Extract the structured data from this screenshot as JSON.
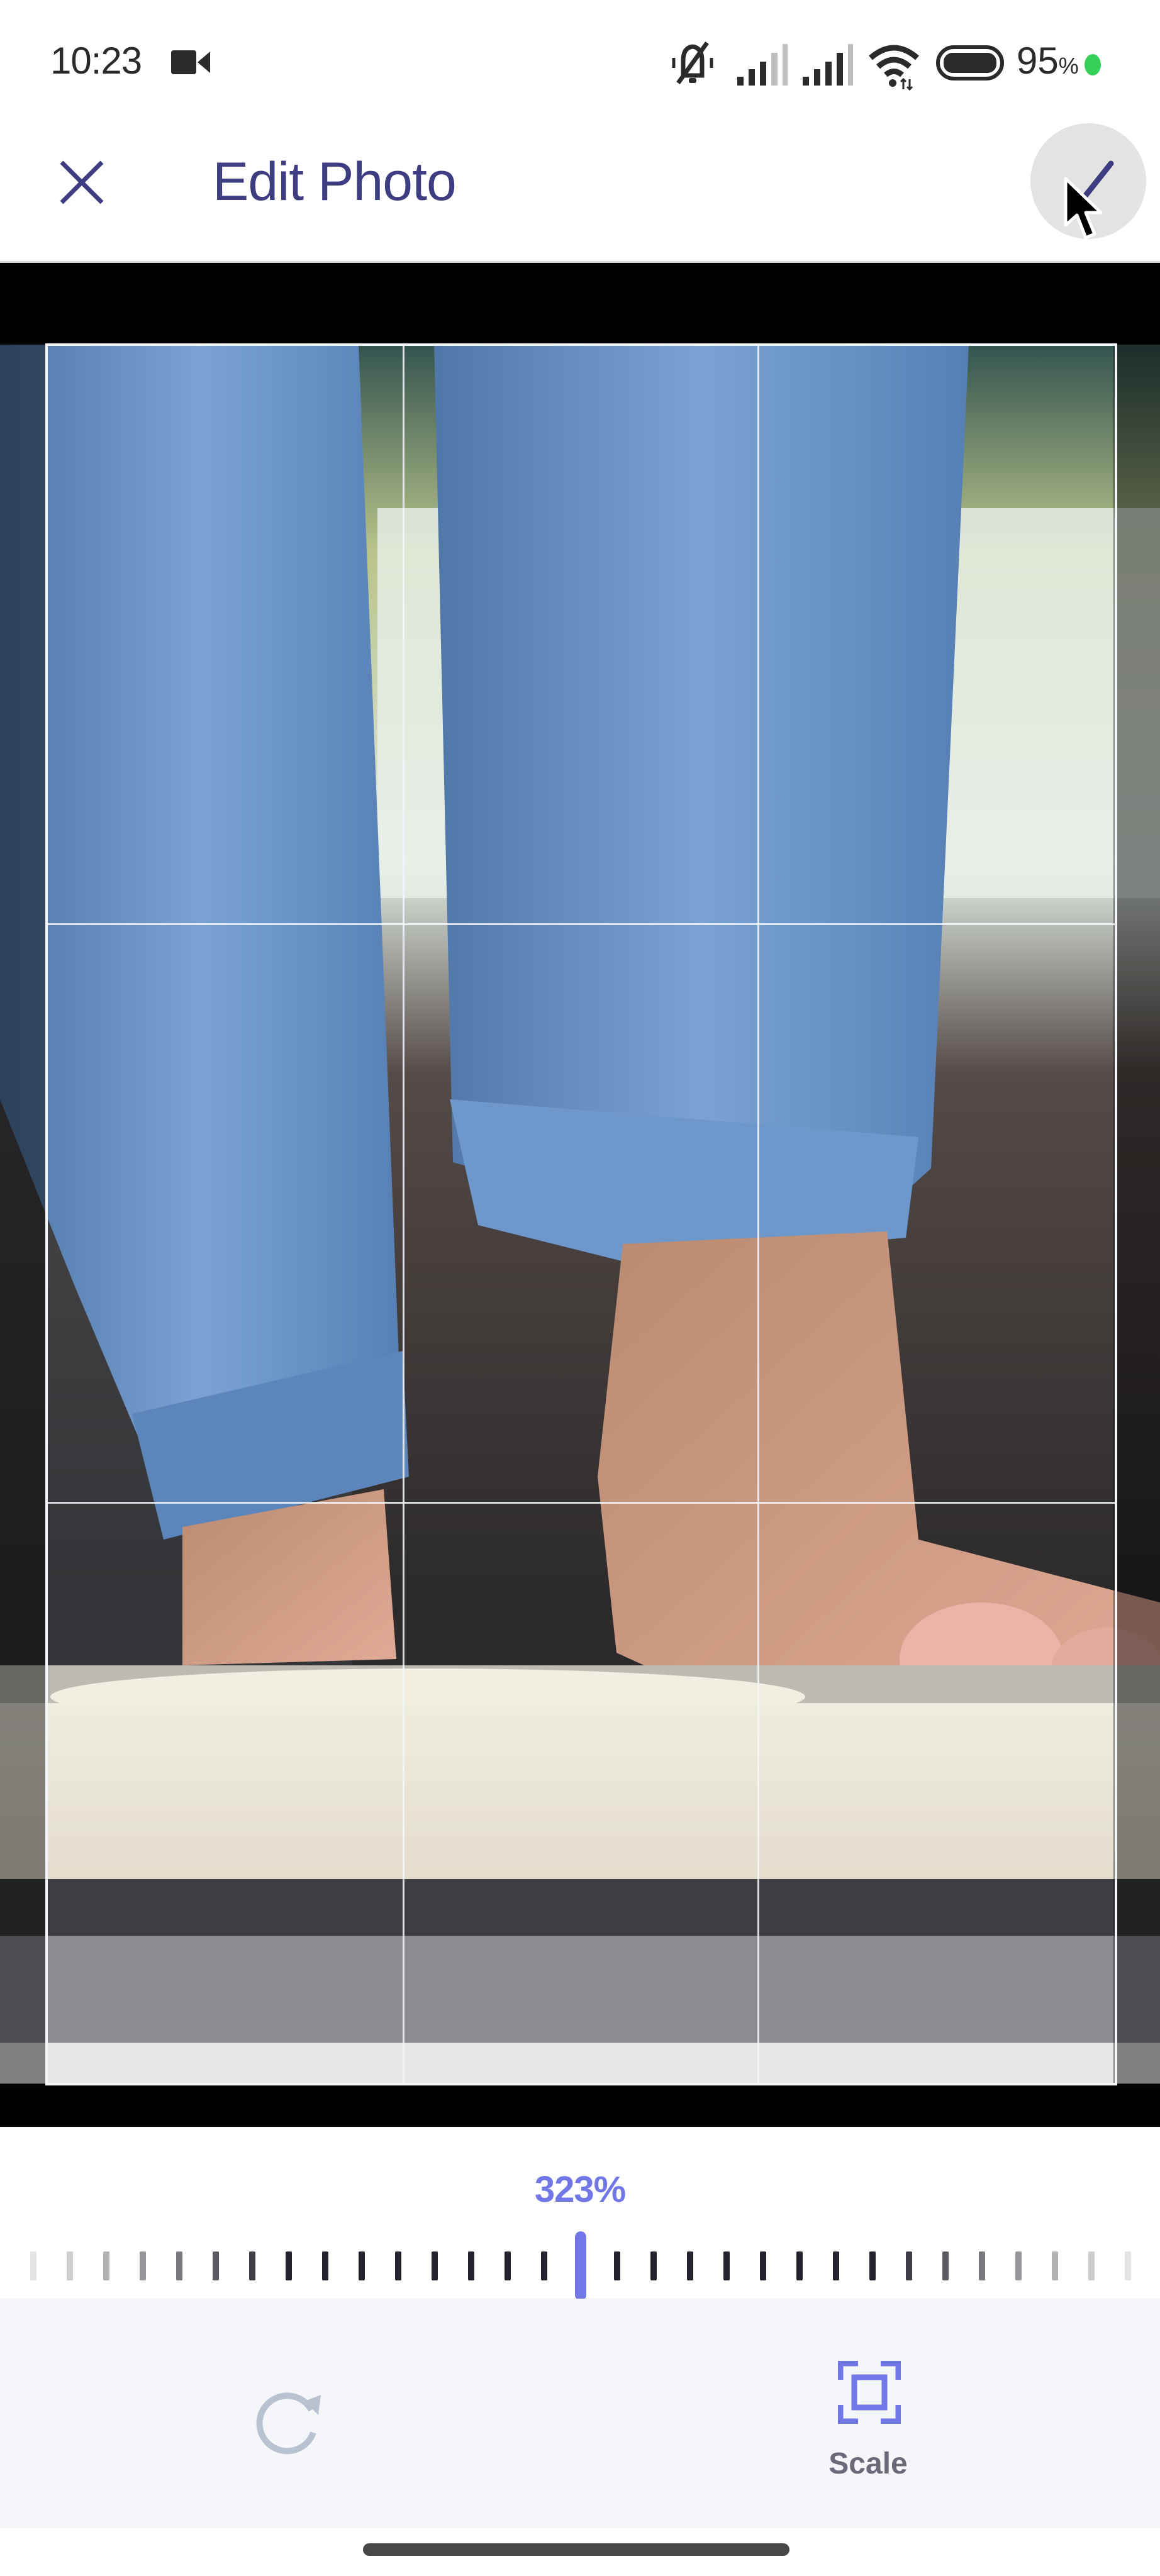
{
  "status_bar": {
    "time": "10:23",
    "recording_icon": "video-camera-icon",
    "icons": [
      "bell-off-icon",
      "signal-icon",
      "signal-icon",
      "wifi-icon",
      "battery-icon"
    ],
    "battery_percent": "95",
    "battery_percent_sign": "%",
    "charging_dot_color": "#34d058"
  },
  "header": {
    "close_icon": "close-icon",
    "title": "Edit Photo",
    "confirm_icon": "checkmark-icon"
  },
  "editor": {
    "crop_grid": "3x3",
    "photo_description": "jeans-and-bare-feet-stepping-onto-bathroom-scale"
  },
  "scale_control": {
    "value_label": "323%",
    "value_percent": 323,
    "ruler_tick_count": 30,
    "accent_color": "#7277e8"
  },
  "toolbar": {
    "rotate_icon": "rotate-icon",
    "scale_icon": "scale-icon",
    "scale_label": "Scale"
  },
  "colors": {
    "title": "#3f3d82",
    "accent": "#7277e8",
    "toolbar_bg": "#f5f6f9",
    "disabled_icon": "#b9c2d0",
    "label_gray": "#6a6a78"
  }
}
